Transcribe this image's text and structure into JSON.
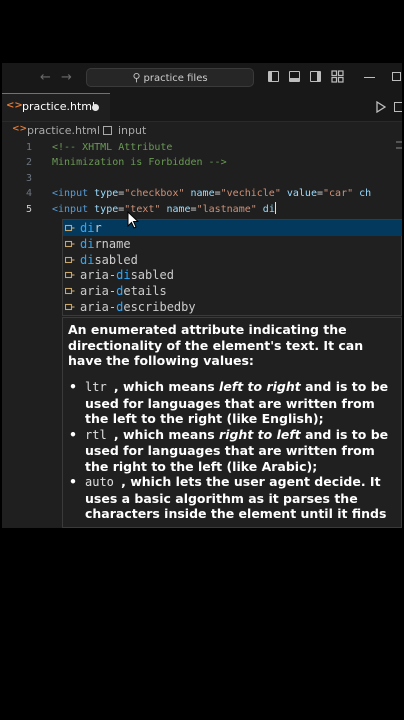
{
  "titlebar": {
    "back_arrow": "←",
    "forward_arrow": "→",
    "search_text": "practice files"
  },
  "tab": {
    "icon_text": "<>",
    "label": "practice.html"
  },
  "breadcrumb": {
    "file": "practice.html",
    "separator": "›",
    "node": "input"
  },
  "code_lines": [
    {
      "n": "1",
      "segments": [
        {
          "c": "comment",
          "t": "<!-- XHTML Attribute"
        }
      ]
    },
    {
      "n": "2",
      "segments": [
        {
          "c": "comment",
          "t": "Minimization is Forbidden -->"
        }
      ]
    },
    {
      "n": "3",
      "segments": []
    },
    {
      "n": "4",
      "segments": [
        {
          "c": "tag",
          "t": "<input "
        },
        {
          "c": "attr",
          "t": "type"
        },
        {
          "c": "text",
          "t": "="
        },
        {
          "c": "str",
          "t": "\"checkbox\" "
        },
        {
          "c": "attr",
          "t": "name"
        },
        {
          "c": "text",
          "t": "="
        },
        {
          "c": "str",
          "t": "\"vechicle\" "
        },
        {
          "c": "attr",
          "t": "value"
        },
        {
          "c": "text",
          "t": "="
        },
        {
          "c": "str",
          "t": "\"car\" "
        },
        {
          "c": "attr",
          "t": "ch"
        }
      ]
    },
    {
      "n": "5",
      "segments": [
        {
          "c": "tag",
          "t": "<input "
        },
        {
          "c": "attr",
          "t": "type"
        },
        {
          "c": "text",
          "t": "="
        },
        {
          "c": "str",
          "t": "\"text\" "
        },
        {
          "c": "attr",
          "t": "name"
        },
        {
          "c": "text",
          "t": "="
        },
        {
          "c": "str",
          "t": "\"lastname\" "
        },
        {
          "c": "attr",
          "t": "di"
        }
      ]
    }
  ],
  "suggestions": [
    {
      "pre": "",
      "match": "di",
      "post": "r",
      "selected": true
    },
    {
      "pre": "",
      "match": "di",
      "post": "rname",
      "selected": false
    },
    {
      "pre": "",
      "match": "di",
      "post": "sabled",
      "selected": false
    },
    {
      "pre": "aria-",
      "match": "di",
      "post": "sabled",
      "selected": false
    },
    {
      "pre": "aria-",
      "match": "d",
      "post": "etails",
      "selected": false
    },
    {
      "pre": "aria-",
      "match": "d",
      "post": "escribedby",
      "selected": false
    }
  ],
  "details": {
    "intro": "An enumerated attribute indicating the directionality of the element's text. It can have the following values:",
    "items": [
      {
        "code": "ltr",
        "a": ", which means ",
        "em": "left to right",
        "b": " and is to be used for languages that are written from the left to the right (like English);"
      },
      {
        "code": "rtl",
        "a": ", which means ",
        "em": "right to left",
        "b": " and is to be used for languages that are written from the right to the left (like Arabic);"
      },
      {
        "code": "auto",
        "a": ", which lets the user agent decide. It uses a basic algorithm as it parses the characters inside the element until it finds a",
        "em": "",
        "b": ""
      }
    ]
  },
  "colors": {
    "accent": "#3b7bd4",
    "selection": "#04395e",
    "match": "#2aaaff",
    "html_icon": "#e37933"
  }
}
